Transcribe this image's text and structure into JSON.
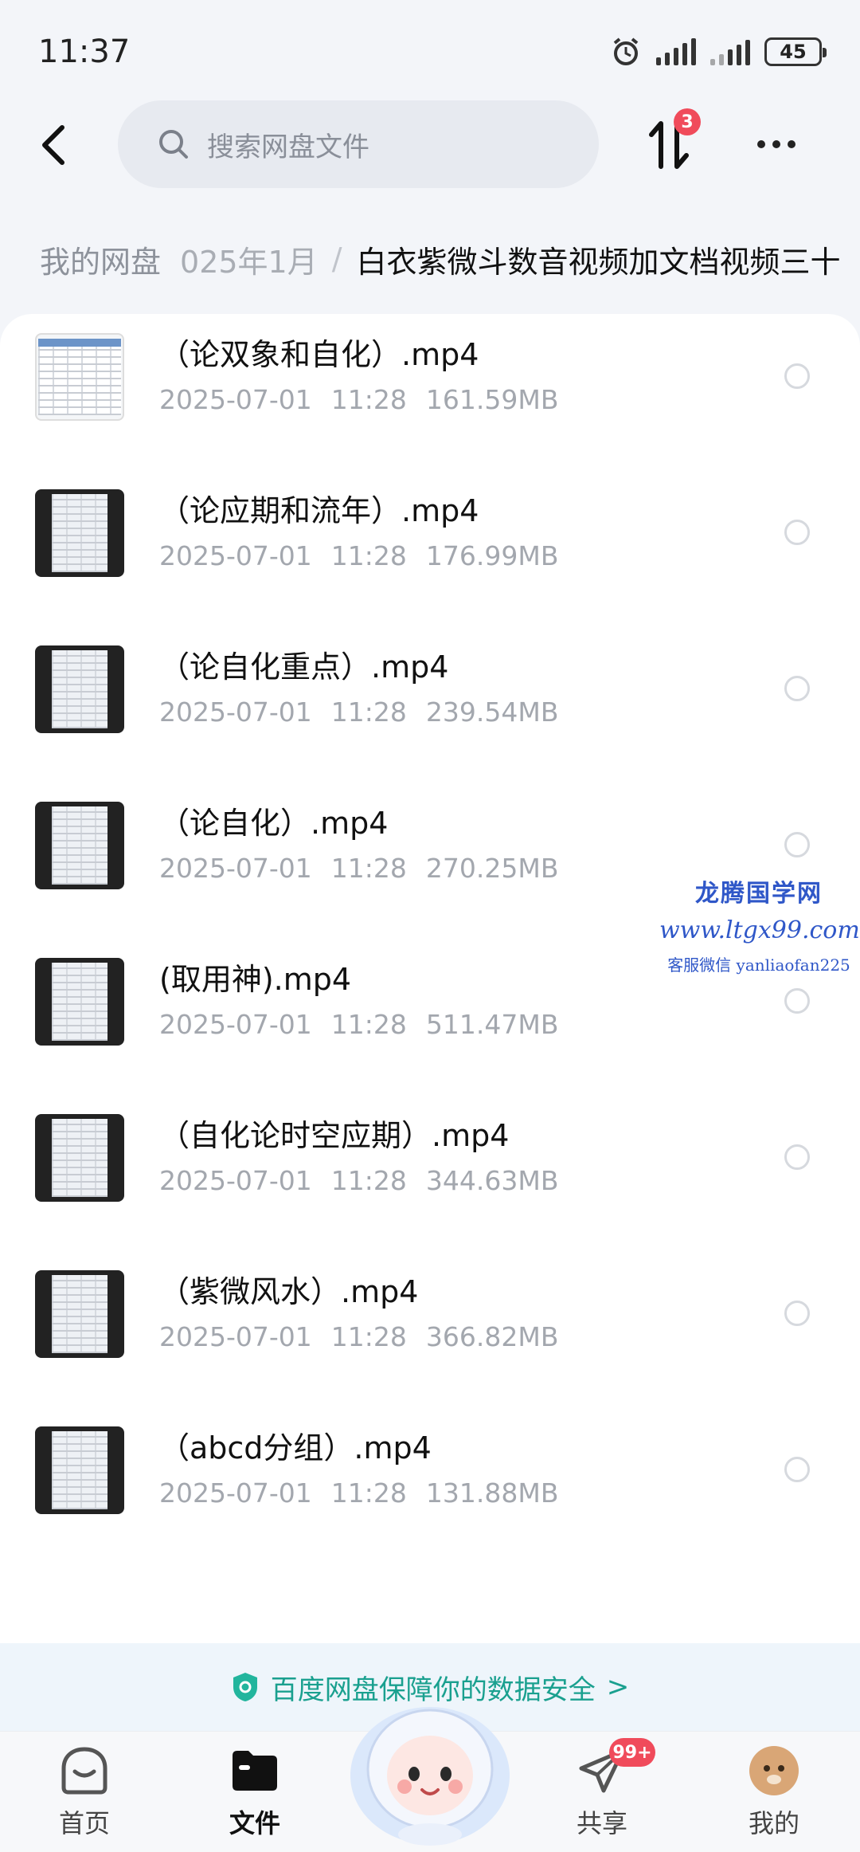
{
  "status": {
    "time": "11:37",
    "battery": "45"
  },
  "header": {
    "search_placeholder": "搜索网盘文件",
    "transfer_badge": "3"
  },
  "breadcrumb": {
    "root": "我的网盘",
    "middle": "025年1月",
    "separator": "/",
    "current": "白衣紫微斗数音视频加文档视频三十"
  },
  "files": [
    {
      "name": "（论双象和自化）.mp4",
      "date": "2025-07-01",
      "time": "11:28",
      "size": "161.59MB",
      "thumb": "light"
    },
    {
      "name": "（论应期和流年）.mp4",
      "date": "2025-07-01",
      "time": "11:28",
      "size": "176.99MB",
      "thumb": "dark"
    },
    {
      "name": "（论自化重点）.mp4",
      "date": "2025-07-01",
      "time": "11:28",
      "size": "239.54MB",
      "thumb": "dark"
    },
    {
      "name": "（论自化）.mp4",
      "date": "2025-07-01",
      "time": "11:28",
      "size": "270.25MB",
      "thumb": "dark"
    },
    {
      "name": "(取用神).mp4",
      "date": "2025-07-01",
      "time": "11:28",
      "size": "511.47MB",
      "thumb": "dark"
    },
    {
      "name": "（自化论时空应期）.mp4",
      "date": "2025-07-01",
      "time": "11:28",
      "size": "344.63MB",
      "thumb": "dark"
    },
    {
      "name": "（紫微风水）.mp4",
      "date": "2025-07-01",
      "time": "11:28",
      "size": "366.82MB",
      "thumb": "dark"
    },
    {
      "name": "（abcd分组）.mp4",
      "date": "2025-07-01",
      "time": "11:28",
      "size": "131.88MB",
      "thumb": "dark"
    }
  ],
  "watermark": {
    "title": "龙腾国学网",
    "url": "www.ltgx99.com",
    "contact": "客服微信 yanliaofan225"
  },
  "safety_banner": {
    "text": "百度网盘保障你的数据安全",
    "chevron": ">"
  },
  "bottom_nav": {
    "items": [
      {
        "label": "首页",
        "icon": "home-icon"
      },
      {
        "label": "文件",
        "icon": "folder-icon",
        "active": true
      },
      {
        "label": "共享",
        "icon": "paper-plane-icon",
        "badge": "99+"
      },
      {
        "label": "我的",
        "icon": "avatar-icon"
      }
    ]
  },
  "colors": {
    "accent_red": "#f04b5b",
    "safety_green": "#1aa08f",
    "watermark_blue": "#2f57c8"
  }
}
